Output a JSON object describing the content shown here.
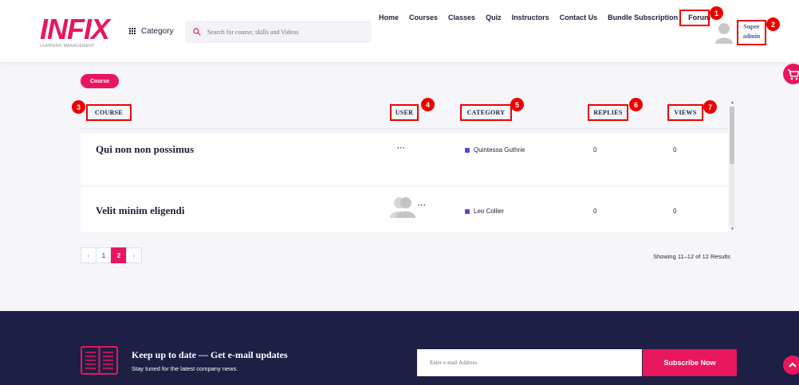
{
  "header": {
    "logo_text": "INFIX",
    "logo_sub": "LEARNING MANAGEMENT",
    "category_label": "Category",
    "search_placeholder": "Search for course, skills and Videos",
    "nav": [
      "Home",
      "Courses",
      "Classes",
      "Quiz",
      "Instructors",
      "Contact Us",
      "Bundle Subscription",
      "Forum"
    ],
    "user_first": "Super",
    "user_last": "admin"
  },
  "annotations": [
    "1",
    "2",
    "3",
    "4",
    "5",
    "6",
    "7"
  ],
  "main": {
    "section_tag": "Course",
    "columns": [
      "COURSE",
      "USER",
      "CATEGORY",
      "REPLIES",
      "VIEWS"
    ],
    "rows": [
      {
        "title": "Qui non non possimus",
        "user": "···",
        "category": "Quintessa Guthrie",
        "replies": "0",
        "views": "0"
      },
      {
        "title": "Velit minim eligendi",
        "user": "···",
        "category": "Leo Collier",
        "replies": "0",
        "views": "0"
      }
    ],
    "pagination": {
      "prev": "‹",
      "pages": [
        "1",
        "2"
      ],
      "current": "2",
      "next": "›"
    },
    "showing": "Showing 11–12 of 12 Results"
  },
  "footer": {
    "title": "Keep up to date — Get e-mail updates",
    "subtitle": "Stay tuned for the latest company news.",
    "email_placeholder": "Enter e-mail Address",
    "subscribe_label": "Subscribe Now"
  },
  "colors": {
    "accent": "#e8175d",
    "footer_bg": "#1d1f45",
    "annotation": "#e00000",
    "category_marker": "#4e4cd8"
  }
}
